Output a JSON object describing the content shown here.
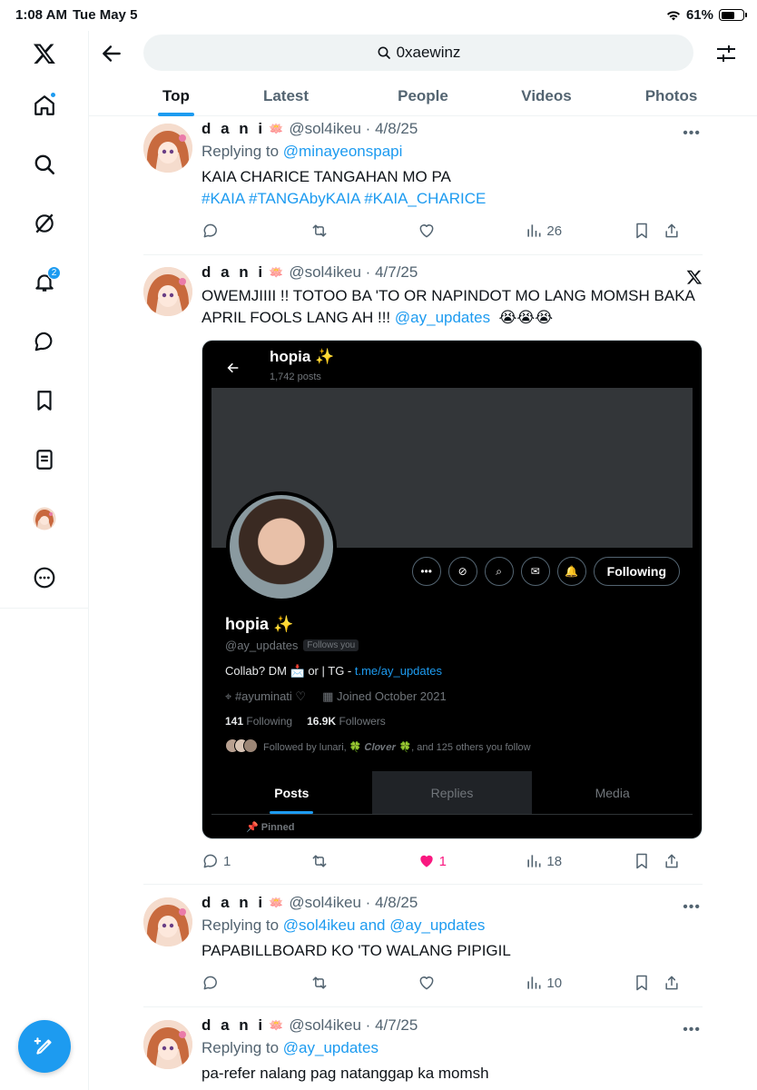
{
  "status": {
    "time": "1:08 AM",
    "date": "Tue May 5",
    "battery": "61%",
    "battery_level": 0.61
  },
  "sidebar": {
    "notifications_badge": "2"
  },
  "search": {
    "query": "0xaewinz"
  },
  "tabs": [
    "Top",
    "Latest",
    "People",
    "Videos",
    "Photos"
  ],
  "tweets": [
    {
      "name": "d a n i",
      "handle": "@sol4ikeu",
      "date": "4/8/25",
      "replying_label": "Replying to",
      "replying": "@minayeonspapi",
      "text": "KAIA CHARICE TANGAHAN MO PA",
      "hashtags": "#KAIA #TANGAbyKAIA #KAIA_CHARICE",
      "replies": "",
      "likes": "",
      "views": "26"
    },
    {
      "name": "d a n i",
      "handle": "@sol4ikeu",
      "date": "4/7/25",
      "text": "OWEMJIIII !! TOTOO BA 'TO OR NAPINDOT MO LANG MOMSH BAKA APRIL FOOLS LANG AH !!!",
      "mention": "@ay_updates",
      "emoji": "😭😭😭",
      "replies": "1",
      "likes": "1",
      "views": "18",
      "media": {
        "title": "hopia ✨",
        "posts": "1,742 posts",
        "name": "hopia ✨",
        "handle": "@ay_updates",
        "follows_you": "Follows you",
        "bio": "Collab? DM 📩 or | TG - ",
        "bio_link": "t.me/ay_updates",
        "location": "#ayuminati ♡",
        "joined": "Joined October 2021",
        "following_count": "141",
        "following_label": "Following",
        "followers_count": "16.9K",
        "followers_label": "Followers",
        "followed_by": "Followed by lunari, 🍀 𝑪𝒍𝒐𝒗𝒆𝒓 🍀, and 125 others you follow",
        "follow_button": "Following",
        "tabs": [
          "Posts",
          "Replies",
          "Media"
        ],
        "pinned": "Pinned"
      }
    },
    {
      "name": "d a n i",
      "handle": "@sol4ikeu",
      "date": "4/8/25",
      "replying_label": "Replying to",
      "replying": "@sol4ikeu and @ay_updates",
      "text": "PAPABILLBOARD KO 'TO WALANG PIPIGIL",
      "replies": "",
      "likes": "",
      "views": "10"
    },
    {
      "name": "d a n i",
      "handle": "@sol4ikeu",
      "date": "4/7/25",
      "replying_label": "Replying to",
      "replying": "@ay_updates",
      "text": "pa-refer nalang pag natanggap ka momsh"
    }
  ],
  "colors": {
    "accent": "#1d9bf0",
    "like": "#f91880",
    "muted": "#536471"
  }
}
